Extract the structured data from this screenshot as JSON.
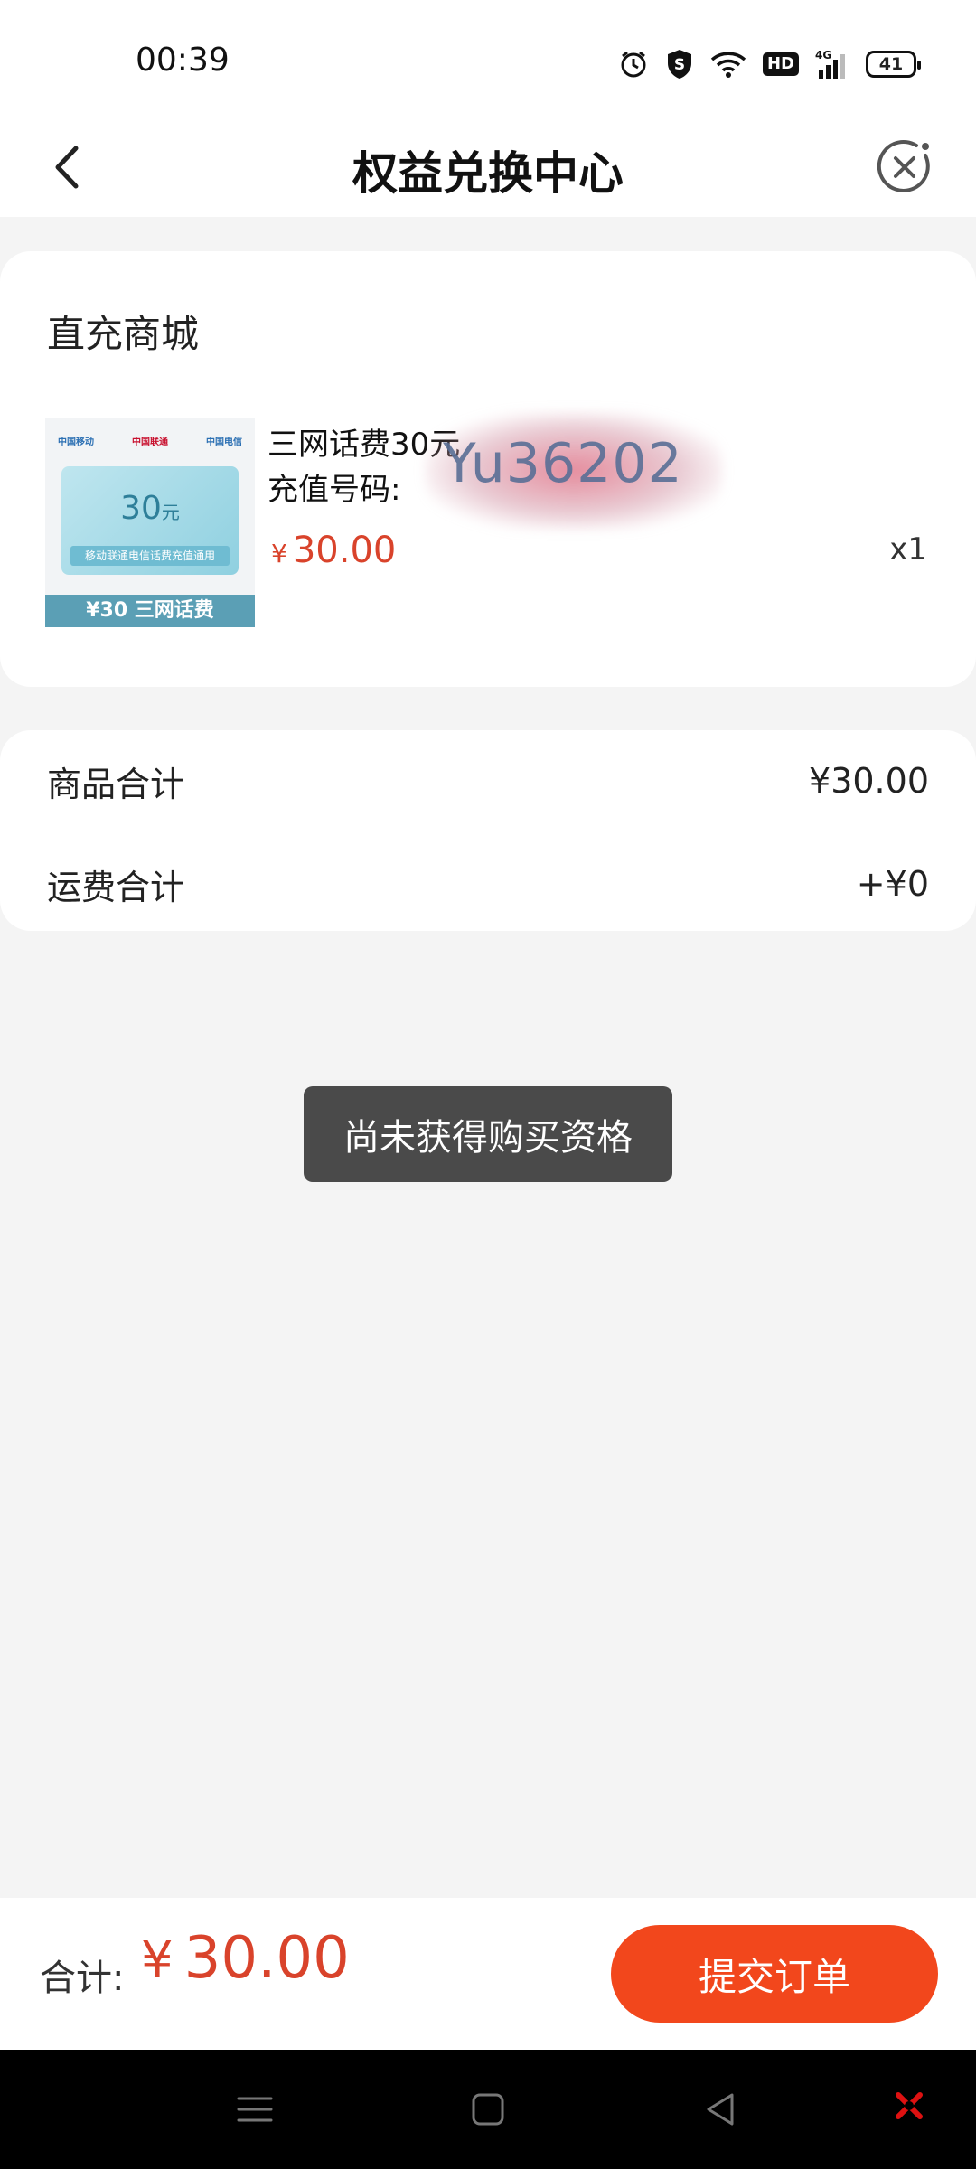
{
  "status_bar": {
    "time": "00:39",
    "network": "4G",
    "hd": "HD",
    "battery": "41",
    "icons": [
      "alarm-icon",
      "shield-s-icon",
      "wifi-icon",
      "hd-icon",
      "signal-icon",
      "battery-icon"
    ]
  },
  "nav": {
    "title": "权益兑换中心",
    "back_icon": "chevron-left-icon",
    "close_icon": "close-circle-icon"
  },
  "shop": {
    "title": "直充商城",
    "product": {
      "name": "三网话费30元",
      "phone_label": "充值号码:",
      "obscured_text": "Yu36202",
      "price_currency": "¥",
      "price": "30.00",
      "quantity": "x1",
      "thumbnail": {
        "logos": [
          "中国移动",
          "中国联通",
          "中国电信"
        ],
        "amount": "30",
        "amount_unit": "元",
        "strip_text": "移动联通电信话费充值通用",
        "footer": "¥30 三网话费"
      }
    }
  },
  "summary": {
    "goods_label": "商品合计",
    "goods_value": "¥30.00",
    "shipping_label": "运费合计",
    "shipping_value": "+¥0"
  },
  "toast": {
    "message": "尚未获得购买资格"
  },
  "bottom": {
    "total_label": "合计:",
    "total_currency": "¥",
    "total_value": "30.00",
    "submit_label": "提交订单"
  },
  "colors": {
    "accent": "#f2471c",
    "price": "#d9432b",
    "toast_bg": "#4a4a4a",
    "background": "#f4f4f4"
  }
}
